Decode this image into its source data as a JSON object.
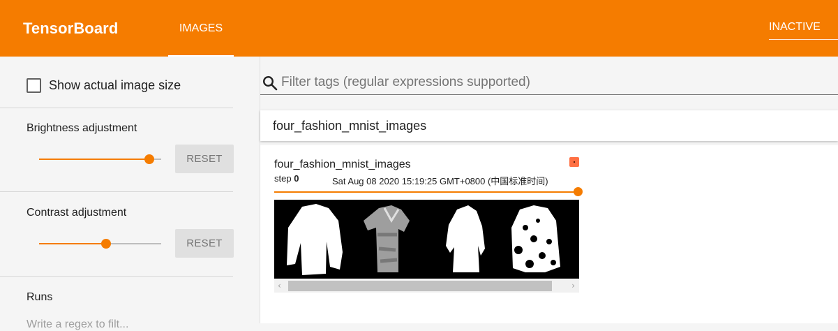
{
  "header": {
    "brand": "TensorBoard",
    "tab_images": "IMAGES",
    "status": "INACTIVE",
    "color": "#f57c00"
  },
  "sidebar": {
    "show_actual_size_label": "Show actual image size",
    "show_actual_size_checked": false,
    "brightness": {
      "label": "Brightness adjustment",
      "value": 0.9,
      "reset_label": "RESET"
    },
    "contrast": {
      "label": "Contrast adjustment",
      "value": 0.55,
      "reset_label": "RESET"
    },
    "runs_label": "Runs",
    "runs_filter_partial": "Write a regex to filt..."
  },
  "main": {
    "filter_placeholder": "Filter tags (regular expressions supported)",
    "group_name": "four_fashion_mnist_images",
    "card": {
      "tag": "four_fashion_mnist_images",
      "step_label": "step",
      "step_value": "0",
      "timestamp": "Sat Aug 08 2020 15:19:25 GMT+0800 (中国标准时间)",
      "run_color": "#ff7043",
      "step_progress": 1.0
    }
  },
  "icons": {
    "search": "search-icon",
    "checkbox": "checkbox-icon",
    "run_color": "run-color-icon"
  }
}
